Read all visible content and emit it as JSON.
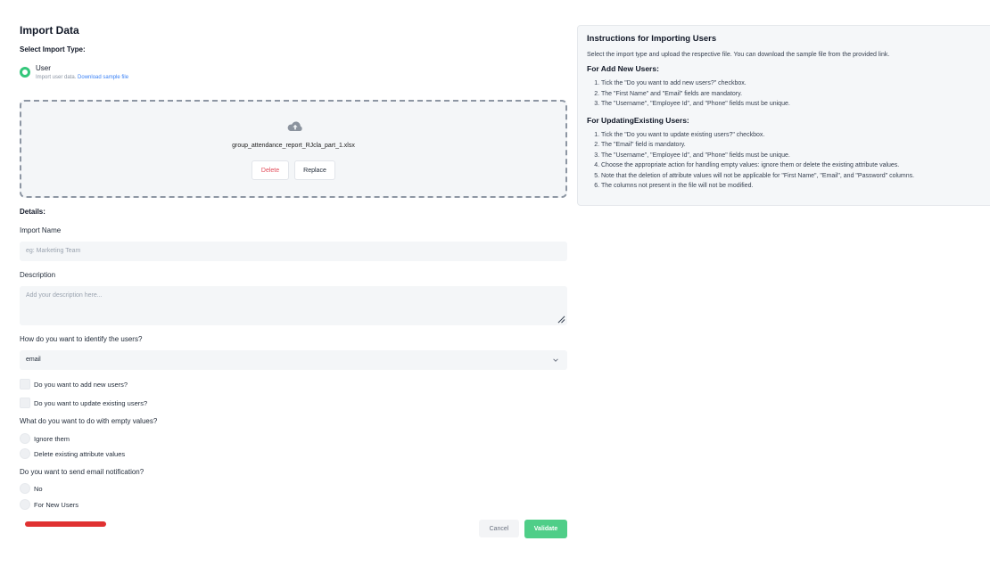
{
  "page": {
    "title": "Import Data",
    "select_type_label": "Select Import Type:",
    "details_label": "Details:"
  },
  "import_type": {
    "option_label": "User",
    "sub_text": "Import user data.",
    "sample_link": "Download sample file"
  },
  "upload": {
    "icon": "cloud-upload-icon",
    "file_name": "group_attendance_report_RJcla_part_1.xlsx",
    "delete_label": "Delete",
    "replace_label": "Replace"
  },
  "form": {
    "import_name_label": "Import Name",
    "import_name_placeholder": "eg: Marketing Team",
    "description_label": "Description",
    "description_placeholder": "Add your description here...",
    "identify_label": "How do you want to identify the users?",
    "identify_value": "email",
    "add_new_label": "Do you want to add new users?",
    "update_existing_label": "Do you want to update existing users?",
    "empty_values_label": "What do you want to do with empty values?",
    "empty_options": [
      "Ignore them",
      "Delete existing attribute values"
    ],
    "email_notify_label": "Do you want to send email notification?",
    "email_options": [
      "No",
      "For New Users"
    ]
  },
  "actions": {
    "cancel_label": "Cancel",
    "validate_label": "Validate"
  },
  "instructions": {
    "title": "Instructions for Importing Users",
    "intro": "Select the import type and upload the respective file. You can download the sample file from the provided link.",
    "add_heading": "For Add New Users:",
    "add_items": [
      "Tick the \"Do you want to add new users?\" checkbox.",
      "The \"First Name\" and \"Email\" fields are mandatory.",
      "The \"Username\", \"Employee Id\", and \"Phone\" fields must be unique."
    ],
    "update_heading": "For UpdatingExisting Users:",
    "update_items": [
      "Tick the \"Do you want to update existing users?\" checkbox.",
      "The \"Email\" field is mandatory.",
      "The \"Username\", \"Employee Id\", and \"Phone\" fields must be unique.",
      "Choose the appropriate action for handling empty values: ignore them or delete the existing attribute values.",
      "Note that the deletion of attribute values will not be applicable for \"First Name\", \"Email\", and \"Password\" columns.",
      "The columns not present in the file will not be modified."
    ]
  },
  "colors": {
    "accent_green": "#4fce88",
    "delete_red": "#e24c5a",
    "link_blue": "#3b82f6",
    "annotation_red": "#e03131"
  }
}
